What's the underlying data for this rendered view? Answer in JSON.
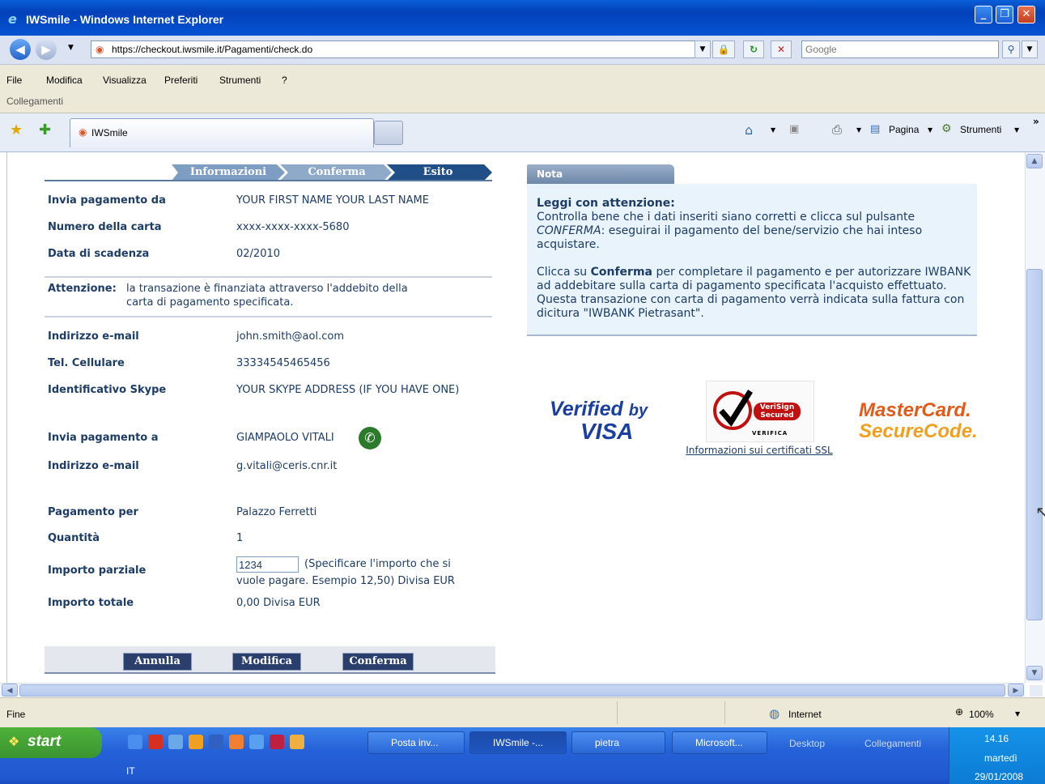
{
  "window": {
    "title": "IWSmile - Windows Internet Explorer"
  },
  "address": {
    "url": "https://checkout.iwsmile.it/Pagamenti/check.do",
    "search_placeholder": "Google"
  },
  "menu": {
    "items": [
      "File",
      "Modifica",
      "Visualizza",
      "Preferiti",
      "Strumenti",
      "?"
    ],
    "links": "Collegamenti"
  },
  "tab": {
    "label": "IWSmile"
  },
  "commandbar": {
    "page": "Pagina",
    "tools": "Strumenti"
  },
  "steps": [
    "Informazioni",
    "Conferma",
    "Esito"
  ],
  "payer": [
    {
      "label": "Invia pagamento da",
      "value": "YOUR FIRST NAME YOUR LAST NAME"
    },
    {
      "label": "Numero della carta",
      "value": "xxxx-xxxx-xxxx-5680"
    },
    {
      "label": "Data di scadenza",
      "value": "02/2010"
    }
  ],
  "attention": {
    "label": "Attenzione:",
    "text1": "la transazione è finanziata attraverso l'addebito della",
    "text2": "carta di pagamento specificata."
  },
  "contacts": [
    {
      "label": "Indirizzo e-mail",
      "value": "john.smith@aol.com"
    },
    {
      "label": "Tel. Cellulare",
      "value": "33334545465456"
    },
    {
      "label": "Identificativo Skype",
      "value": "YOUR SKYPE ADDRESS (IF YOU HAVE ONE)"
    }
  ],
  "recipient": [
    {
      "label": "Invia pagamento a",
      "value": "GIAMPAOLO VITALI"
    },
    {
      "label": "Indirizzo e-mail",
      "value": "g.vitali@ceris.cnr.it"
    }
  ],
  "payment": {
    "for_label": "Pagamento per",
    "for_value": "Palazzo Ferretti",
    "qty_label": "Quantità",
    "qty_value": "1",
    "partial_label": "Importo parziale",
    "partial_input": "1234",
    "partial_hint1": "(Specificare l'importo che si",
    "partial_hint2": "vuole pagare. Esempio 12,50) Divisa EUR",
    "total_label": "Importo totale",
    "total_value": "0,00 Divisa EUR"
  },
  "buttons": {
    "cancel": "Annulla",
    "edit": "Modifica",
    "confirm": "Conferma"
  },
  "nota": {
    "tab": "Nota",
    "heading": "Leggi con attenzione:",
    "p1a": "Controlla bene che i dati inseriti siano corretti e clicca sul pulsante",
    "p1b_em": "CONFERMA",
    "p1c": ": eseguirai il pagamento del bene/servizio che hai inteso acquistare.",
    "p2a": "Clicca su ",
    "p2b_bold": "Conferma",
    "p2c": " per completare il pagamento e per autorizzare IWBANK ad addebitare sulla carta di pagamento specificata l'acquisto effettuato. Questa transazione con carta di pagamento verrà indicata sulla fattura con dicitura \"IWBANK Pietrasant\"."
  },
  "badges": {
    "visa_line1": "Verified",
    "visa_by": "by",
    "visa_line2": "VISA",
    "verisign1": "VeriSign",
    "verisign2": "Secured",
    "verisign3": "VERIFICA",
    "ssl_link": "Informazioni sui certificati SSL",
    "mc1": "MasterCard.",
    "mc2": "SecureCode."
  },
  "status": {
    "left": "Fine",
    "zone": "Internet",
    "zoom": "100%"
  },
  "taskbar": {
    "start": "start",
    "items": [
      "Posta inv...",
      "IWSmile -...",
      "pietra",
      "Microsoft..."
    ],
    "desktop": "Desktop",
    "links": "Collegamenti",
    "lang": "IT",
    "time": "14.16",
    "day": "martedì",
    "date": "29/01/2008"
  },
  "colors": {
    "accent": "#1d3c66",
    "step_active": "#1f4f86",
    "xp_blue": "#2561d8"
  }
}
